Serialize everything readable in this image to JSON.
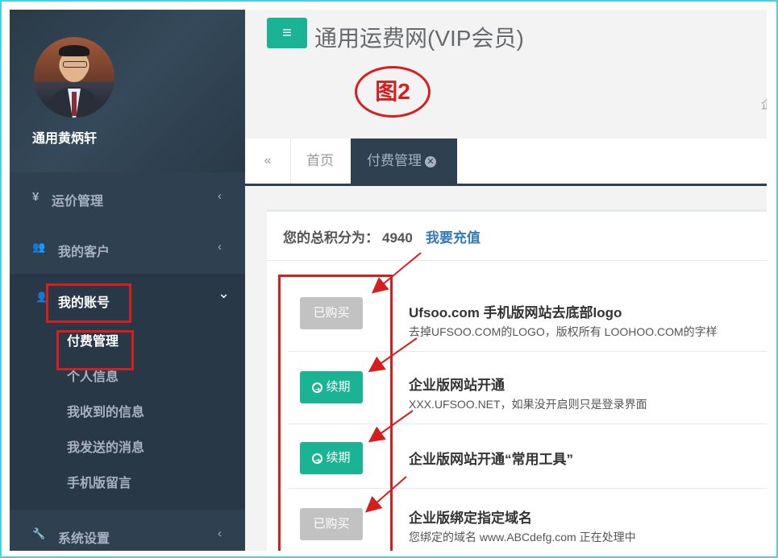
{
  "profile": {
    "name": "通用黄炳轩"
  },
  "sidebar": {
    "items": [
      {
        "icon": "¥",
        "label": "运价管理",
        "chevron": "‹"
      },
      {
        "icon": "👥",
        "label": "我的客户",
        "chevron": "‹"
      },
      {
        "icon": "👤",
        "label": "我的账号",
        "chevron": "⌄"
      },
      {
        "icon": "🔧",
        "label": "系统设置",
        "chevron": "‹"
      }
    ],
    "submenu": [
      "付费管理",
      "个人信息",
      "我收到的信息",
      "我发送的消息",
      "手机版留言"
    ]
  },
  "header": {
    "menu_icon": "≡",
    "title": "通用运费网(VIP会员)",
    "annotation": "图2",
    "edge_char": "企"
  },
  "tabs": {
    "back_icon": "«",
    "home": "首页",
    "active": "付费管理",
    "close_icon": "✕"
  },
  "account": {
    "points_label": "您的总积分为：",
    "points_value": "4940",
    "recharge": "我要充值"
  },
  "items": [
    {
      "button": "已购买",
      "button_type": "gray",
      "title": "Ufsoo.com 手机版网站去底部logo",
      "desc": "去掉UFSOO.COM的LOGO，版权所有 LOOHOO.COM的字样"
    },
    {
      "button": "续期",
      "button_type": "green",
      "title": "企业版网站开通",
      "desc": "XXX.UFSOO.NET，如果没开启则只是登录界面"
    },
    {
      "button": "续期",
      "button_type": "green",
      "title": "企业版网站开通“常用工具”",
      "desc": ""
    },
    {
      "button": "已购买",
      "button_type": "gray",
      "title": "企业版绑定指定域名",
      "desc": "您绑定的域名 www.ABCdefg.com 正在处理中"
    }
  ],
  "colors": {
    "accent": "#1ab394",
    "sidebar": "#2f4050",
    "annotation_red": "#d61e1e",
    "link": "#337ab7"
  }
}
